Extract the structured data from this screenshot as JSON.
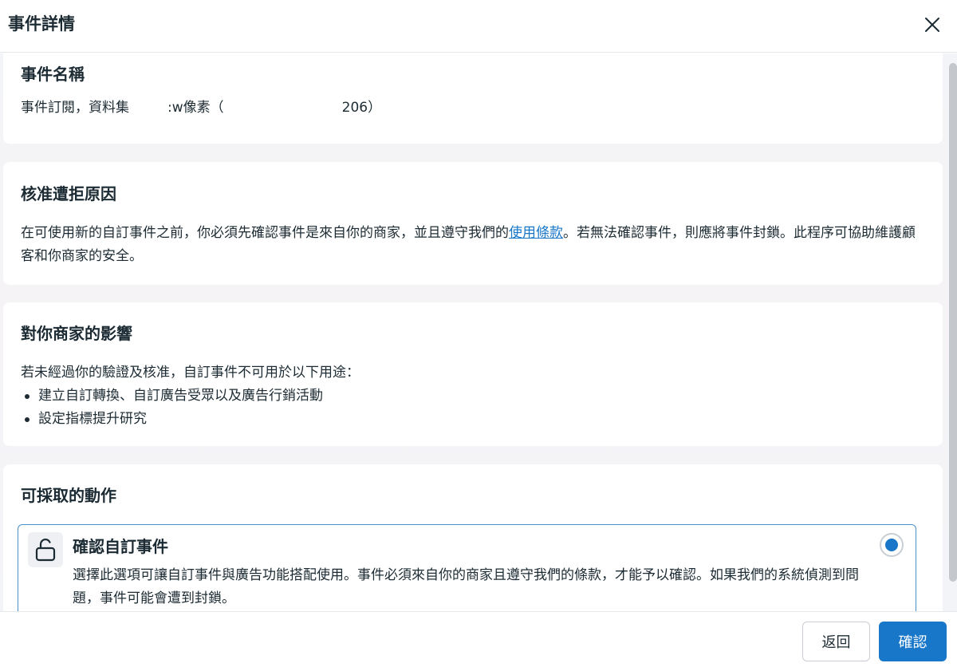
{
  "header": {
    "title": "事件詳情"
  },
  "event_name": {
    "title": "事件名稱",
    "text_part1": "事件訂閱，資料集",
    "text_part2": ":w像素（",
    "text_part3": "206）"
  },
  "rejection": {
    "title": "核准遭拒原因",
    "text_before_link": "在可使用新的自訂事件之前，你必須先確認事件是來自你的商家，並且遵守我們的",
    "link": "使用條款",
    "text_after_link": "。若無法確認事件，則應將事件封鎖。此程序可協助維護顧客和你商家的安全。"
  },
  "impact": {
    "title": "對你商家的影響",
    "intro": "若未經過你的驗證及核准，自訂事件不可用於以下用途：",
    "bullets": [
      "建立自訂轉換、自訂廣告受眾以及廣告行銷活動",
      "設定指標提升研究"
    ]
  },
  "actions": {
    "title": "可採取的動作",
    "option": {
      "title": "確認自訂事件",
      "description": "選擇此選項可讓自訂事件與廣告功能搭配使用。事件必須來自你的商家且遵守我們的條款，才能予以確認。如果我們的系統偵測到問題，事件可能會遭到封鎖。",
      "icon": "unlock-icon",
      "selected": true
    }
  },
  "footer": {
    "back_label": "返回",
    "confirm_label": "確認"
  },
  "colors": {
    "accent": "#1877c9",
    "text": "#1c2b33",
    "option_border": "#4a90c9"
  }
}
